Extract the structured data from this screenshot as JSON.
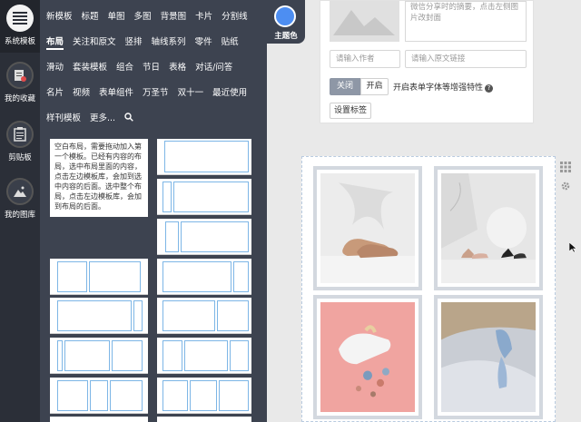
{
  "rail": {
    "items": [
      {
        "label": "系统模板",
        "icon": "hamburger-icon"
      },
      {
        "label": "我的收藏",
        "icon": "favorites-icon"
      },
      {
        "label": "剪贴板",
        "icon": "clipboard-icon"
      },
      {
        "label": "我的图库",
        "icon": "gallery-icon"
      }
    ]
  },
  "nav": {
    "row1": [
      "新模板",
      "标题",
      "单图",
      "多图",
      "背景图",
      "卡片",
      "分割线"
    ],
    "row2": [
      "布局",
      "关注和原文",
      "竖排",
      "轴线系列",
      "零件",
      "贴纸"
    ],
    "row3": [
      "滑动",
      "套装模板",
      "组合",
      "节日",
      "表格",
      "对话/问答"
    ],
    "row4": [
      "名片",
      "视频",
      "表单组件",
      "万圣节",
      "双十一",
      "最近使用"
    ],
    "row5": [
      "样刊模板",
      "更多..."
    ],
    "active": "布局",
    "search_icon": "search-icon"
  },
  "theme": {
    "label": "主题色",
    "color": "#4d8ef2"
  },
  "layout_tip": "空白布局，需要拖动加入第一个模板。已经有内容的布局，选中布局里面的内容，点击左边模板库，会加到选中内容的后面。选中整个布局，点击左边模板库，会加到布局的后面。",
  "form": {
    "summary_placeholder": "微信分享时的摘要，点击左侧图片改封面",
    "author_placeholder": "请输入作者",
    "link_placeholder": "请输入原文链接",
    "toggle_off": "关闭",
    "toggle_on": "开启",
    "toggle_state": "off",
    "option_label": "开启表单字体等增强特性",
    "set_tag_button": "设置标签"
  },
  "right_icons": [
    "grid-icon",
    "gear-icon"
  ]
}
